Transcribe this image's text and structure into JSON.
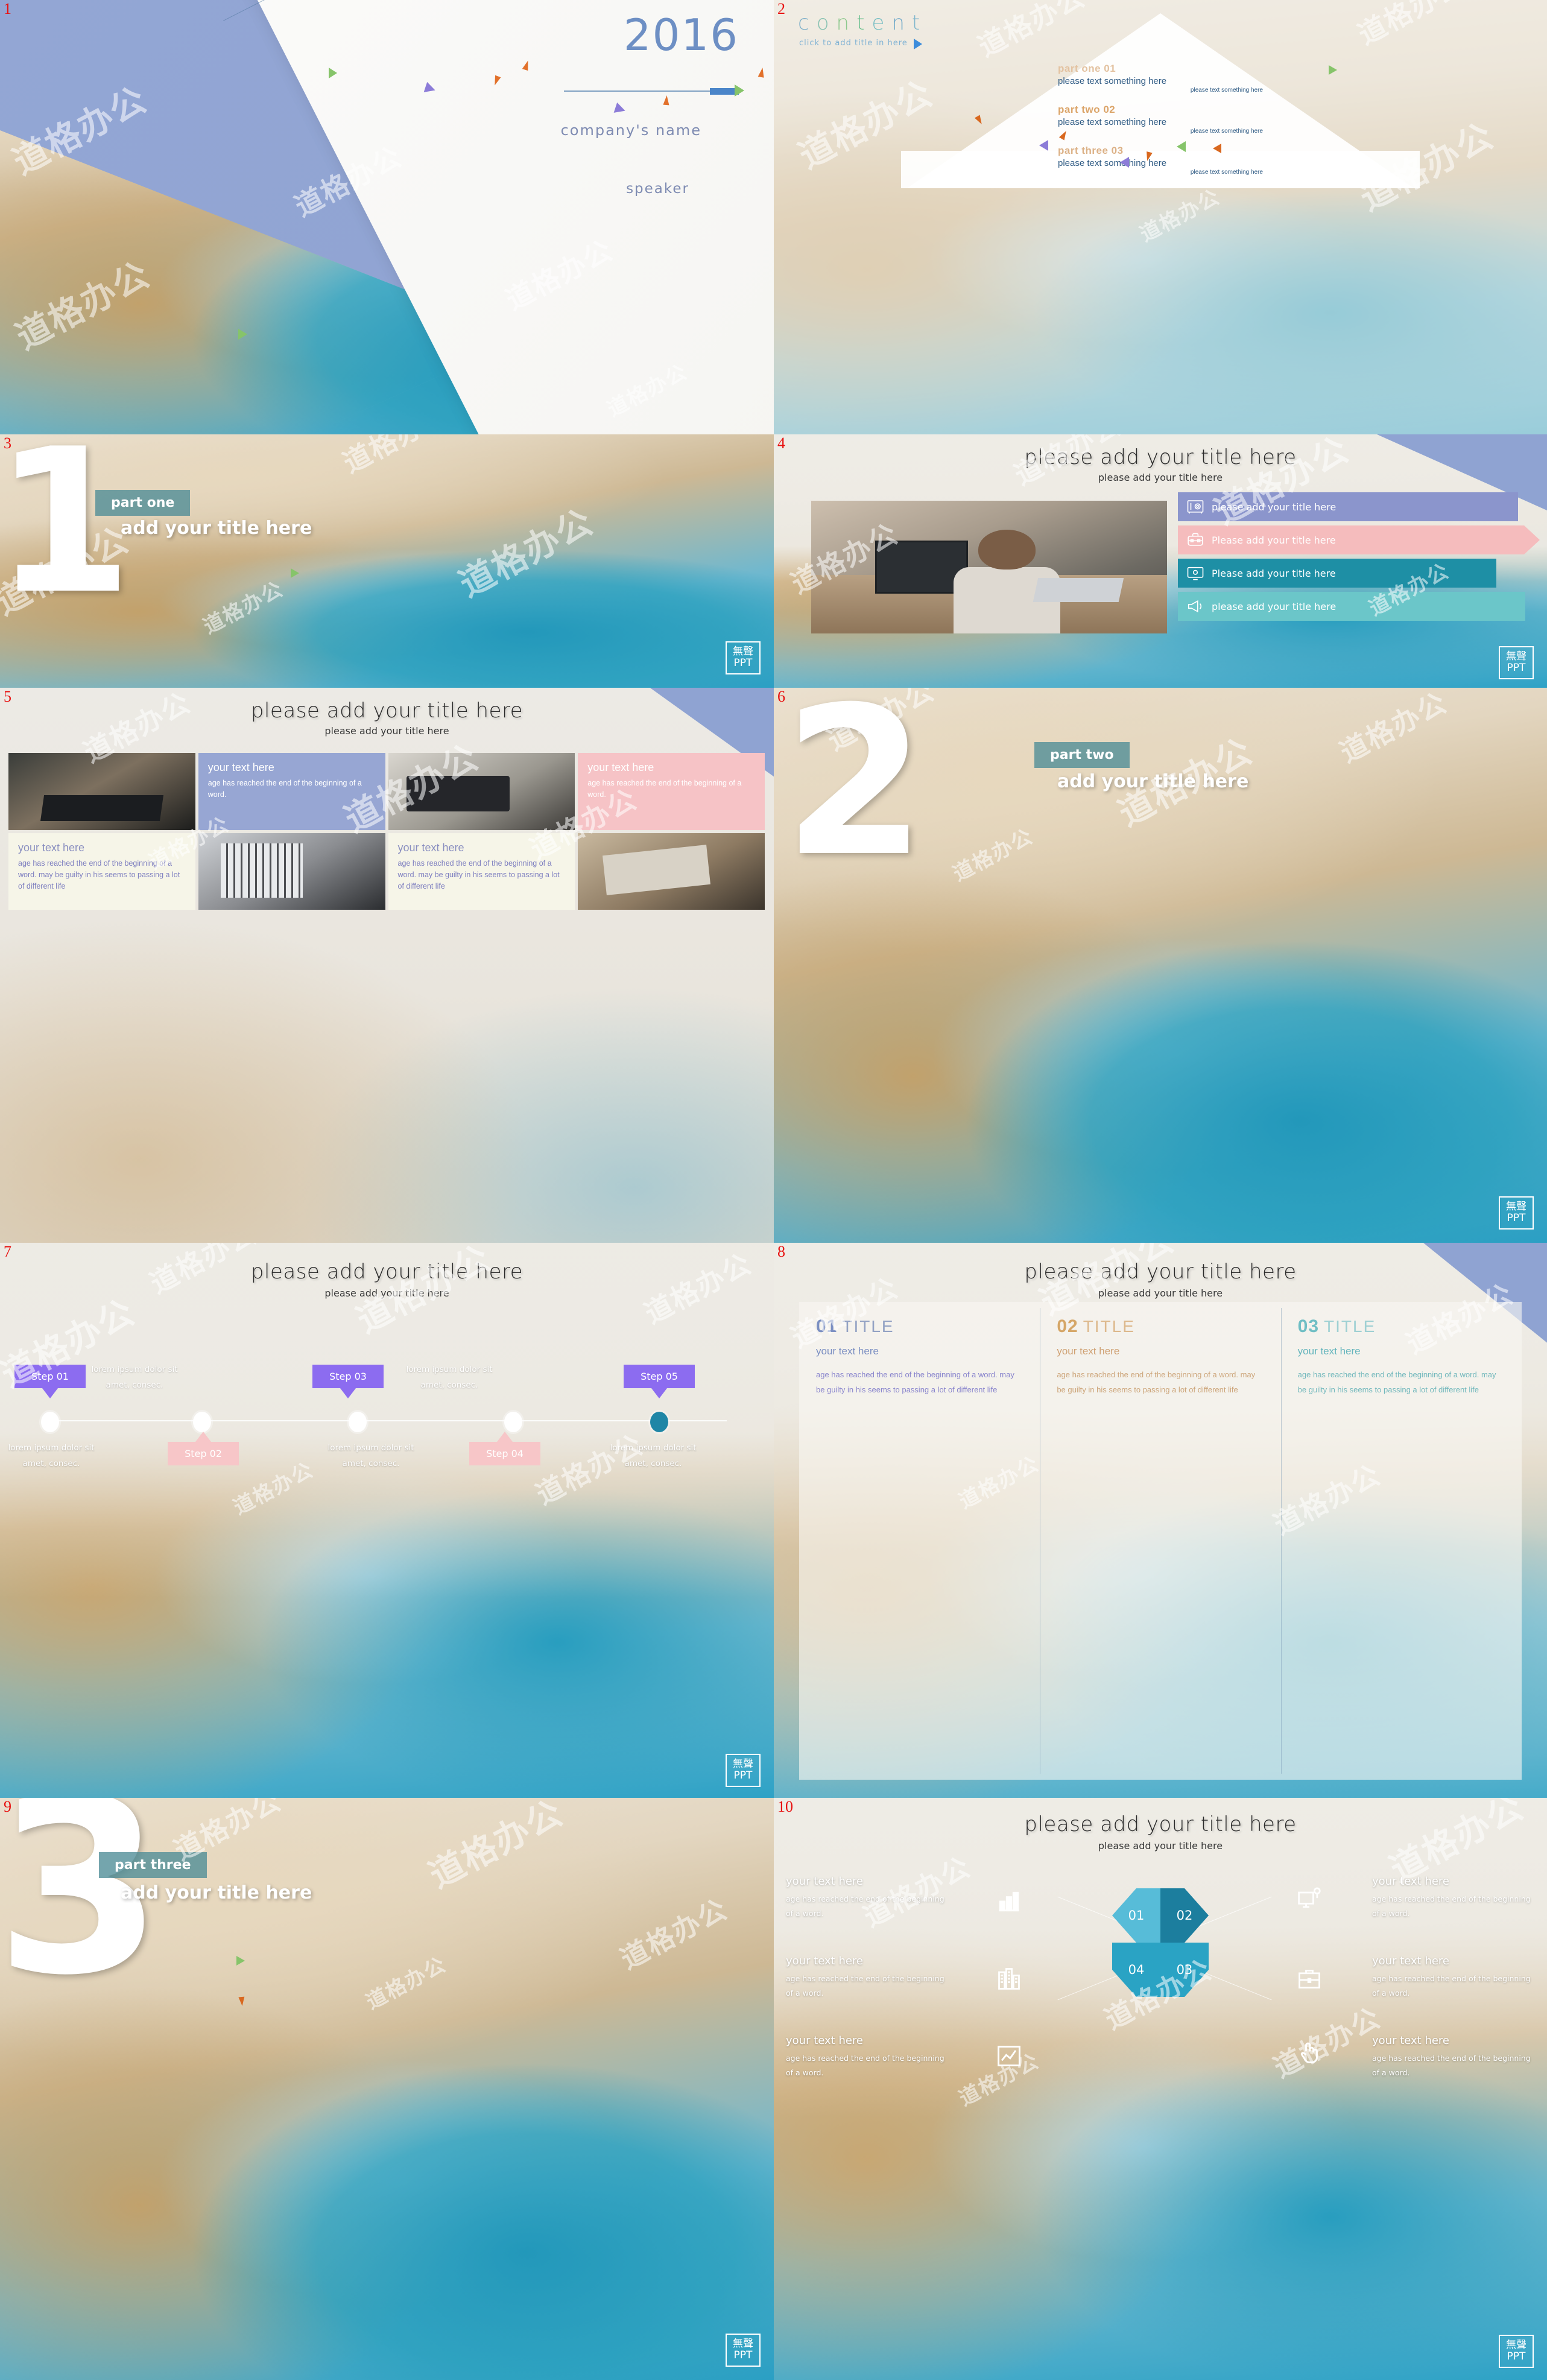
{
  "deck": {
    "badge": {
      "line1": "無聲",
      "line2": "PPT"
    },
    "watermark": "道格办公"
  },
  "slides": [
    {
      "number": "1",
      "name": "cover",
      "year": "2016",
      "company": "company's  name",
      "speaker": "speaker"
    },
    {
      "number": "2",
      "name": "content",
      "title_letters": [
        "c",
        "o",
        "n",
        "t",
        "e",
        "n",
        "t"
      ],
      "title": "content",
      "subtitle": "click to add title in here",
      "items": [
        {
          "key": "part one 01",
          "line1": "please text something here",
          "line2": "please text something here"
        },
        {
          "key": "part two 02",
          "line1": "please text something here",
          "line2": "please text something here"
        },
        {
          "key": "part three 03",
          "line1": "please text something here",
          "line2": "please text something here"
        }
      ]
    },
    {
      "number": "3",
      "name": "section-one",
      "big": "1",
      "tag": "part one",
      "title": "add your title here"
    },
    {
      "number": "4",
      "name": "icon-bars",
      "title": "please add your title here",
      "subtitle": "please add your title here",
      "bars": [
        {
          "label": "please add your title here",
          "icon": "safe-icon",
          "color": "#8b95cc"
        },
        {
          "label": "Please add your title here",
          "icon": "briefcase-icon",
          "color": "#f5bcbd"
        },
        {
          "label": "Please add your title here",
          "icon": "monitor-icon",
          "color": "#1e8fa5"
        },
        {
          "label": "please add your title here",
          "icon": "megaphone-icon",
          "color": "#6bc6c9"
        }
      ]
    },
    {
      "number": "5",
      "name": "photo-grid",
      "title": "please add your title here",
      "subtitle": "please add your title here",
      "cells": [
        {
          "type": "photo",
          "photo": "laptop-typing"
        },
        {
          "type": "text",
          "variant": "blue",
          "title": "your text here",
          "body": "age has reached the end of the beginning of a word."
        },
        {
          "type": "photo",
          "photo": "calculator-desk"
        },
        {
          "type": "text",
          "variant": "pink",
          "title": "your text here",
          "body": "age has reached the end of the beginning of a word."
        },
        {
          "type": "text",
          "variant": "cream",
          "title": "your text here",
          "body": "age has reached the end of the beginning of a word. may be guilty in his seems to passing a lot of different life"
        },
        {
          "type": "photo",
          "photo": "office-meeting"
        },
        {
          "type": "text",
          "variant": "cream",
          "title": "your text here",
          "body": "age has reached the end of the beginning of a word. may be guilty in his seems to passing a lot of different life"
        },
        {
          "type": "photo",
          "photo": "tablet-desk"
        }
      ]
    },
    {
      "number": "6",
      "name": "section-two",
      "big": "2",
      "tag": "part two",
      "title": "add your title here"
    },
    {
      "number": "7",
      "name": "steps-timeline",
      "title": "please add your title here",
      "subtitle": "please add your title here",
      "steps": [
        {
          "label": "Step 01",
          "color": "purple",
          "position": "top"
        },
        {
          "label": "Step 02",
          "color": "pink",
          "position": "bottom"
        },
        {
          "label": "Step 03",
          "color": "purple",
          "position": "top"
        },
        {
          "label": "Step 04",
          "color": "pink",
          "position": "bottom"
        },
        {
          "label": "Step 05",
          "color": "purple",
          "position": "top"
        }
      ],
      "captions": [
        "lorem ipsum dolor sit amet, consec.",
        "lorem ipsum dolor sit amet, consec.",
        "lorem ipsum dolor sit amet, consec.",
        "lorem ipsum dolor sit amet, consec.",
        "lorem ipsum dolor sit amet, consec."
      ]
    },
    {
      "number": "8",
      "name": "three-columns",
      "title": "please add your title here",
      "subtitle": "please add your title here",
      "columns": [
        {
          "num": "01",
          "title": "TITLE",
          "sub": "your text here",
          "body": "age has reached the end of the beginning of a word. may be guilty in his seems to passing a lot of different life",
          "color": "#7b8fc2"
        },
        {
          "num": "02",
          "title": "TITLE",
          "sub": "your text here",
          "body": "age has reached the end of the beginning of a word. may be guilty in his seems to passing a lot of different life",
          "color": "#d5a667"
        },
        {
          "num": "03",
          "title": "TITLE",
          "sub": "your text here",
          "body": "age has reached the end of the beginning of a word. may be guilty in his seems to passing a lot of different life",
          "color": "#6fbec4"
        }
      ]
    },
    {
      "number": "9",
      "name": "section-three",
      "big": "3",
      "tag": "part three",
      "title": "add your title here"
    },
    {
      "number": "10",
      "name": "hexagon-infographic",
      "title": "please add your title here",
      "subtitle": "please add your title here",
      "hexagon": [
        "01",
        "02",
        "03",
        "04"
      ],
      "items": [
        {
          "title": "your text here",
          "body": "age has reached the end of the beginning of a word.",
          "icon": "bar-chart-icon",
          "side": "left"
        },
        {
          "title": "your text here",
          "body": "age has reached the end of the beginning of a word.",
          "icon": "display-icon",
          "side": "right"
        },
        {
          "title": "your text here",
          "body": "age has reached the end of the beginning of a word.",
          "icon": "buildings-icon",
          "side": "left"
        },
        {
          "title": "your text here",
          "body": "age has reached the end of the beginning of a word.",
          "icon": "briefcase-icon",
          "side": "right"
        },
        {
          "title": "your text here",
          "body": "age has reached the end of the beginning of a word.",
          "icon": "line-chart-icon",
          "side": "left"
        },
        {
          "title": "your text here",
          "body": "age has reached the end of the beginning of a word.",
          "icon": "hand-click-icon",
          "side": "right"
        }
      ]
    }
  ]
}
